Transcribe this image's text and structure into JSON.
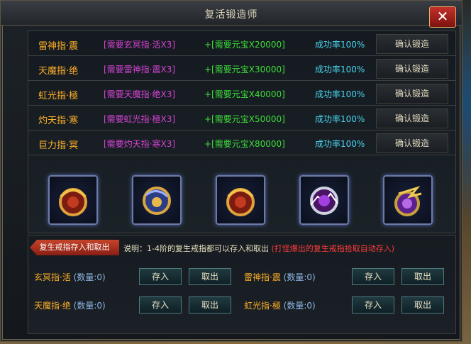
{
  "dialog": {
    "title": "复活锻造师",
    "close_label": "✕"
  },
  "forge_rows": [
    {
      "name": "雷神指·震",
      "requirement": "[需要玄冥指·活X3]",
      "cost": "+[需要元宝X20000]",
      "rate": "成功率100%",
      "button": "确认锻造"
    },
    {
      "name": "天魔指·绝",
      "requirement": "[需要雷神指·震X3]",
      "cost": "+[需要元宝X30000]",
      "rate": "成功率100%",
      "button": "确认锻造"
    },
    {
      "name": "虹光指·極",
      "requirement": "[需要天魔指·绝X3]",
      "cost": "+[需要元宝X40000]",
      "rate": "成功率100%",
      "button": "确认锻造"
    },
    {
      "name": "灼天指·寒",
      "requirement": "[需要虹光指·極X3]",
      "cost": "+[需要元宝X50000]",
      "rate": "成功率100%",
      "button": "确认锻造"
    },
    {
      "name": "巨力指·冥",
      "requirement": "[需要灼天指·寒X3]",
      "cost": "+[需要元宝X80000]",
      "rate": "成功率100%",
      "button": "确认锻造"
    }
  ],
  "rings": [
    {
      "icon": "ring-gold-red-icon",
      "color": "#b23a1f"
    },
    {
      "icon": "ring-blue-gold-icon",
      "color": "#3552a8"
    },
    {
      "icon": "ring-gold-red-icon",
      "color": "#b23a1f"
    },
    {
      "icon": "ring-purple-silver-icon",
      "color": "#7a2a9e"
    },
    {
      "icon": "ring-gold-purple-icon",
      "color": "#8a3fc0"
    }
  ],
  "storage": {
    "tab_label": "复生戒指存入和取出",
    "note_prefix": "说明：1-4阶的复生戒指都可以存入和取出",
    "note_suffix": "(打怪爆出的复生戒指拾取自动存入)",
    "slots": [
      {
        "name": "玄冥指·活",
        "count": "(数量:0)",
        "deposit": "存入",
        "withdraw": "取出"
      },
      {
        "name": "雷神指·震",
        "count": "(数量:0)",
        "deposit": "存入",
        "withdraw": "取出"
      },
      {
        "name": "天魔指·绝",
        "count": "(数量:0)",
        "deposit": "存入",
        "withdraw": "取出"
      },
      {
        "name": "虹光指·極",
        "count": "(数量:0)",
        "deposit": "存入",
        "withdraw": "取出"
      }
    ]
  }
}
